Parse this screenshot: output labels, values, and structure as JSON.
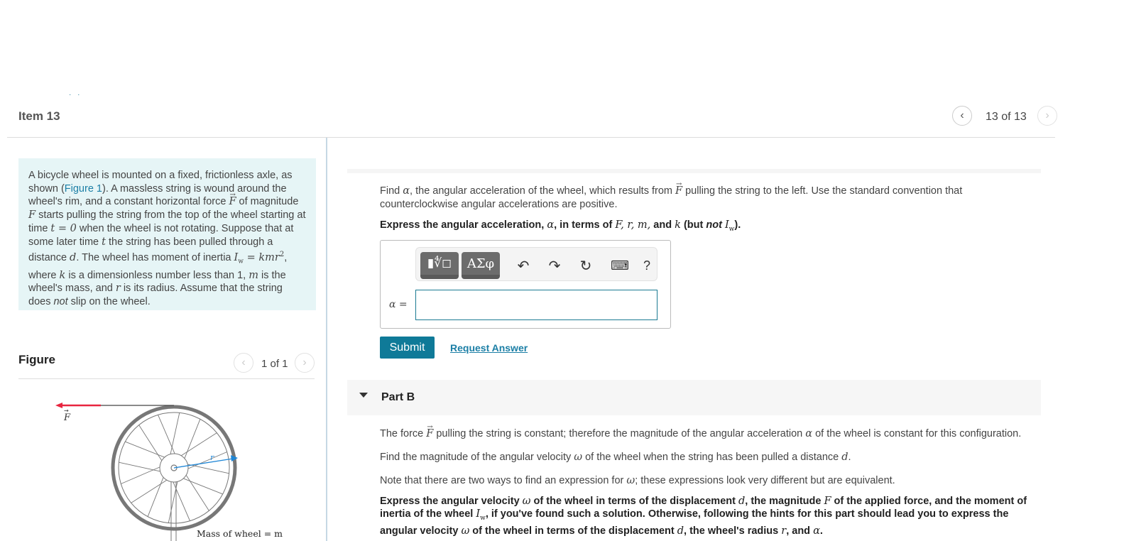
{
  "header": {
    "top_dots": "· ·",
    "item_title": "Item 13",
    "pager": {
      "text": "13 of 13",
      "prev": "‹",
      "next": "›"
    }
  },
  "intro": {
    "t1": "A bicycle wheel is mounted on a fixed, frictionless axle, as shown (",
    "figure_link": "Figure 1",
    "t2": "). A massless string is wound around the wheel's rim, and a constant horizontal force ",
    "F": "F",
    "t3": " of magnitude ",
    "F2": "F",
    "t4": " starts pulling the string from the top of the wheel starting at time ",
    "t_eq": "t = 0",
    "t5": " when the wheel is not rotating. Suppose that at some later time ",
    "t": "t",
    "t6": " the string has been pulled through a distance ",
    "d": "d",
    "t7": ". The wheel has moment of inertia ",
    "Iw": "I",
    "w_sub": "w",
    "eq": " = kmr",
    "sq": "2",
    "t8": ", where ",
    "k": "k",
    "t9": " is a dimensionless number less than 1, ",
    "m": "m",
    "t10": " is the wheel's mass, and ",
    "r": "r",
    "t11": " is its radius. Assume that the string does ",
    "not": "not",
    "t12": " slip on the wheel."
  },
  "figure": {
    "title": "Figure",
    "pager": {
      "text": "1 of 1",
      "prev": "‹",
      "next": "›"
    },
    "force_label": "F",
    "radius_label": "r",
    "mass_label": "Mass of wheel = m",
    "colors": {
      "force": "#e8253f",
      "radius": "#1f86d6",
      "tire": "#777777"
    }
  },
  "partA": {
    "q1a": "Find ",
    "alpha": "α",
    "q1b": ", the angular acceleration of the wheel, which results from ",
    "F": "F",
    "q1c": " pulling the string to the left. Use the standard convention that counterclockwise angular accelerations are positive.",
    "q2a": "Express the angular acceleration, ",
    "q2b": ", in terms of ",
    "vars": "F, r, m,",
    "q2c": " and ",
    "k": "k",
    "q2d": " (but ",
    "not": "not",
    "Iw": "I",
    "w_sub": "w",
    "q2e": ").",
    "toolbar": {
      "templates_label": "▮∜◻",
      "greek_label": "ΑΣφ",
      "undo": "↶",
      "redo": "↷",
      "reset": "↻",
      "keyboard": "⌨",
      "help": "?"
    },
    "answer_label": "α =",
    "answer_value": "",
    "submit_label": "Submit",
    "request_answer_label": "Request Answer"
  },
  "partB": {
    "title": "Part B",
    "p1a": "The force ",
    "F": "F",
    "p1b": " pulling the string is constant; therefore the magnitude of the angular acceleration ",
    "alpha": "α",
    "p1c": " of the wheel is constant for this configuration.",
    "p2a": "Find the magnitude of the angular velocity ",
    "omega": "ω",
    "p2b": " of the wheel when the string has been pulled a distance ",
    "d": "d",
    "p2c": ".",
    "p3a": "Note that there are two ways to find an expression for ",
    "p3b": "; these expressions look very different but are equivalent.",
    "p4a": "Express the angular velocity ",
    "p4b": " of the wheel in terms of the displacement ",
    "p4c": ", the magnitude ",
    "p4d": " of the applied force, and the moment of inertia of the wheel ",
    "Iw": "I",
    "w_sub": "w",
    "p4e": ", if you've found such a solution. Otherwise, following the hints for this part should lead you to express the angular velocity ",
    "p4f": " of the wheel in terms of the displacement ",
    "p4g": ", the wheel's radius ",
    "r": "r",
    "p4h": ", and ",
    "p4i": "."
  }
}
